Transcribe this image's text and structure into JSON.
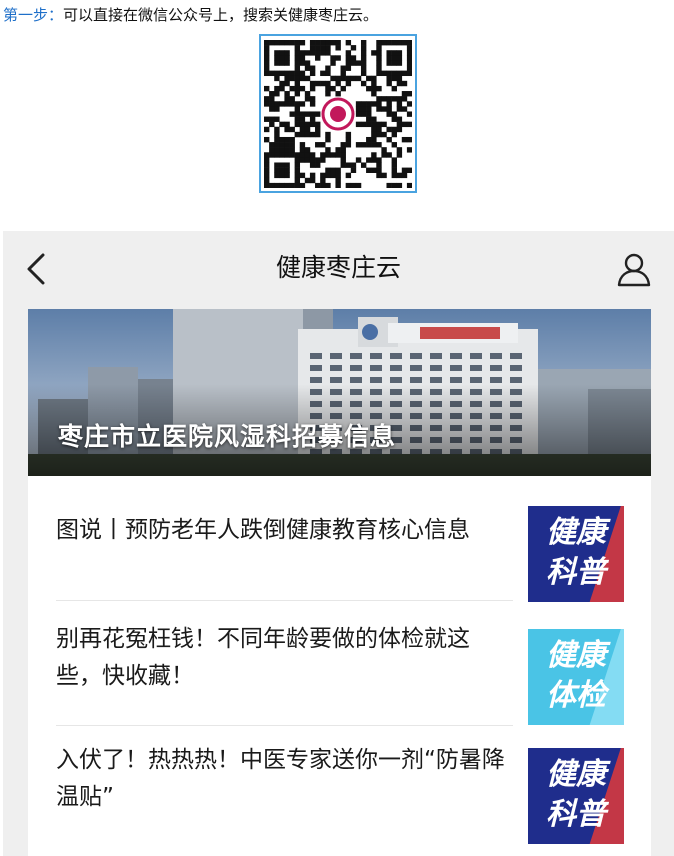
{
  "instruction": {
    "step_label": "第一步：",
    "text": "可以直接在微信公众号上，搜索关健康枣庄云。"
  },
  "qr_code": {
    "center_logo_color": "#c2185b",
    "border_color": "#4aa3e0"
  },
  "app": {
    "title": "健康枣庄云",
    "back_icon": "chevron-left-icon",
    "user_icon": "user-icon"
  },
  "banner": {
    "caption": "枣庄市立医院风湿科招募信息"
  },
  "articles": [
    {
      "headline": "图说丨预防老年人跌倒健康教育核心信息",
      "thumb_line1": "健康",
      "thumb_line2": "科普",
      "thumb_bg": "#1f2d8c",
      "thumb_accent": "#e03a3a"
    },
    {
      "headline": "别再花冤枉钱！不同年龄要做的体检就这些，快收藏！",
      "thumb_line1": "健康",
      "thumb_line2": "体检",
      "thumb_bg": "#4ac4e6",
      "thumb_accent": "#8ee0f5"
    },
    {
      "headline": "入伏了！热热热！中医专家送你一剂“防暑降温贴”",
      "thumb_line1": "健康",
      "thumb_line2": "科普",
      "thumb_bg": "#1f2d8c",
      "thumb_accent": "#e03a3a"
    }
  ]
}
